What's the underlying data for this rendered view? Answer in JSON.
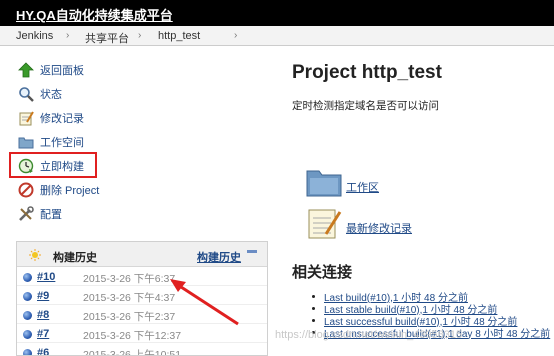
{
  "header": {
    "title": "HY.QA自动化持续集成平台"
  },
  "breadcrumb": {
    "items": [
      "Jenkins",
      "共享平台",
      "http_test"
    ]
  },
  "sidebar": {
    "tasks": [
      {
        "label": "返回面板",
        "icon": "up-arrow-icon"
      },
      {
        "label": "状态",
        "icon": "search-icon"
      },
      {
        "label": "修改记录",
        "icon": "notepad-icon"
      },
      {
        "label": "工作空间",
        "icon": "folder-icon"
      },
      {
        "label": "立即构建",
        "icon": "build-clock-icon"
      },
      {
        "label": "删除 Project",
        "icon": "no-entry-icon"
      },
      {
        "label": "配置",
        "icon": "tools-icon"
      }
    ]
  },
  "build_history": {
    "title": "构建历史",
    "link": "构建历史",
    "rows": [
      {
        "num": "#10",
        "date": "2015-3-26 下午6:37"
      },
      {
        "num": "#9",
        "date": "2015-3-26 下午4:37"
      },
      {
        "num": "#8",
        "date": "2015-3-26 下午2:37"
      },
      {
        "num": "#7",
        "date": "2015-3-26 下午12:37"
      },
      {
        "num": "#6",
        "date": "2015-3-26 上午10:51"
      }
    ]
  },
  "main": {
    "title": "Project http_test",
    "description": "定时检测指定域名是否可以访问",
    "workspace_link": "工作区",
    "changes_link": "最新修改记录",
    "related_heading": "相关连接",
    "related_links": [
      "Last build(#10),1 小时 48 分之前",
      "Last stable build(#10),1 小时 48 分之前",
      "Last successful build(#10),1 小时 48 分之前",
      "Last unsuccessful build(#1),1 day 8 小时 48 分之前"
    ]
  },
  "watermark": "https://blog.csdn.net/weixin_43958315"
}
